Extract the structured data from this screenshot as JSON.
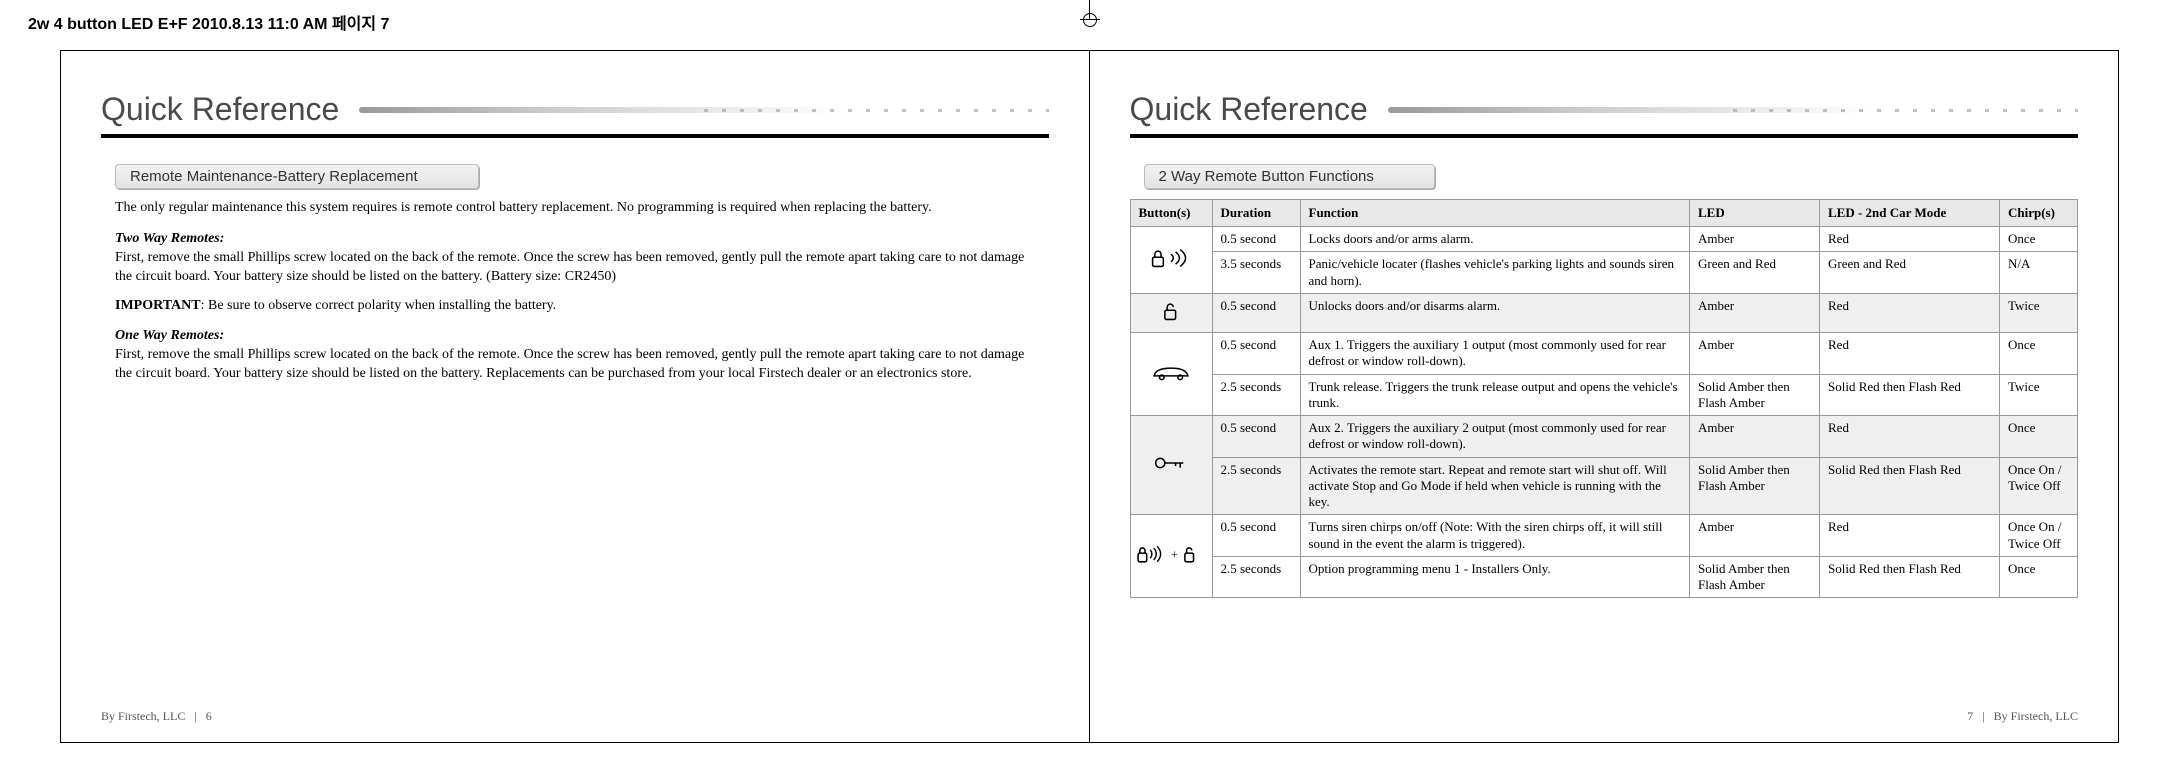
{
  "print_header": "2w 4 button LED E+F  2010.8.13 11:0 AM  페이지 7",
  "left": {
    "title": "Quick Reference",
    "section_tab": "Remote Maintenance-Battery Replacement",
    "intro": "The only regular maintenance this system requires is remote control battery replacement.    No programming is required when replacing the battery.",
    "two_way_head": "Two Way Remotes:",
    "two_way_body": "First, remove the small Phillips screw located on the back of the remote. Once the screw has been removed, gently pull the remote apart taking care to not damage the circuit board. Your battery size should be listed on the battery. (Battery size: CR2450)",
    "two_way_important_label": "IMPORTANT",
    "two_way_important_text": ":  Be sure to observe correct polarity when installing the battery.",
    "one_way_head": "One Way Remotes:",
    "one_way_body": "First, remove the small Phillips screw located on the back of the remote. Once the screw has been removed, gently pull the remote apart taking care to not damage the circuit board. Your battery size should be listed on the battery. Replacements can be purchased from your local Firstech dealer or an electronics store.",
    "footer_by": "By Firstech, LLC",
    "footer_sep": "|",
    "footer_page": "6"
  },
  "right": {
    "title": "Quick Reference",
    "section_tab": "2 Way Remote Button Functions",
    "table": {
      "headers": {
        "buttons": "Button(s)",
        "duration": "Duration",
        "function": "Function",
        "led": "LED",
        "led2": "LED  - 2nd Car Mode",
        "chirp": "Chirp(s)"
      },
      "rows": {
        "r0": {
          "duration": "0.5 second",
          "function": "Locks doors and/or arms alarm.",
          "led": "Amber",
          "led2": "Red",
          "chirp": "Once"
        },
        "r1": {
          "duration": "3.5 seconds",
          "function": "Panic/vehicle locater (flashes vehicle's parking lights and sounds siren and horn).",
          "led": "Green and Red",
          "led2": "Green and Red",
          "chirp": "N/A"
        },
        "r2": {
          "duration": "0.5 second",
          "function": "Unlocks doors and/or disarms alarm.",
          "led": "Amber",
          "led2": "Red",
          "chirp": "Twice"
        },
        "r3": {
          "duration": "0.5 second",
          "function": "Aux 1. Triggers the auxiliary 1 output (most commonly used for rear defrost or window roll-down).",
          "led": "Amber",
          "led2": "Red",
          "chirp": "Once"
        },
        "r4": {
          "duration": "2.5 seconds",
          "function": "Trunk release. Triggers the trunk release output and opens the vehicle's trunk.",
          "led": "Solid Amber then Flash Amber",
          "led2": "Solid Red then Flash Red",
          "chirp": "Twice"
        },
        "r5": {
          "duration": "0.5 second",
          "function": "Aux 2. Triggers the auxiliary 2 output (most commonly used for rear defrost or window roll-down).",
          "led": "Amber",
          "led2": "Red",
          "chirp": "Once"
        },
        "r6": {
          "duration": "2.5 seconds",
          "function": "Activates the remote start. Repeat and remote start will shut off. Will activate Stop and Go Mode if held when vehicle is running with the key.",
          "led": "Solid Amber then Flash Amber",
          "led2": "Solid Red then Flash Red",
          "chirp": "Once On / Twice Off"
        },
        "r7": {
          "duration": "0.5 second",
          "function": "Turns siren chirps on/off (Note: With the siren chirps off, it will still sound in the event the alarm is triggered).",
          "led": "Amber",
          "led2": "Red",
          "chirp": "Once On / Twice Off"
        },
        "r8": {
          "duration": "2.5 seconds",
          "function": "Option programming menu 1 - Installers Only.",
          "led": "Solid Amber then Flash Amber",
          "led2": "Solid Red then Flash Red",
          "chirp": "Once"
        }
      }
    },
    "footer_page": "7",
    "footer_sep": "|",
    "footer_by": "By Firstech, LLC"
  }
}
